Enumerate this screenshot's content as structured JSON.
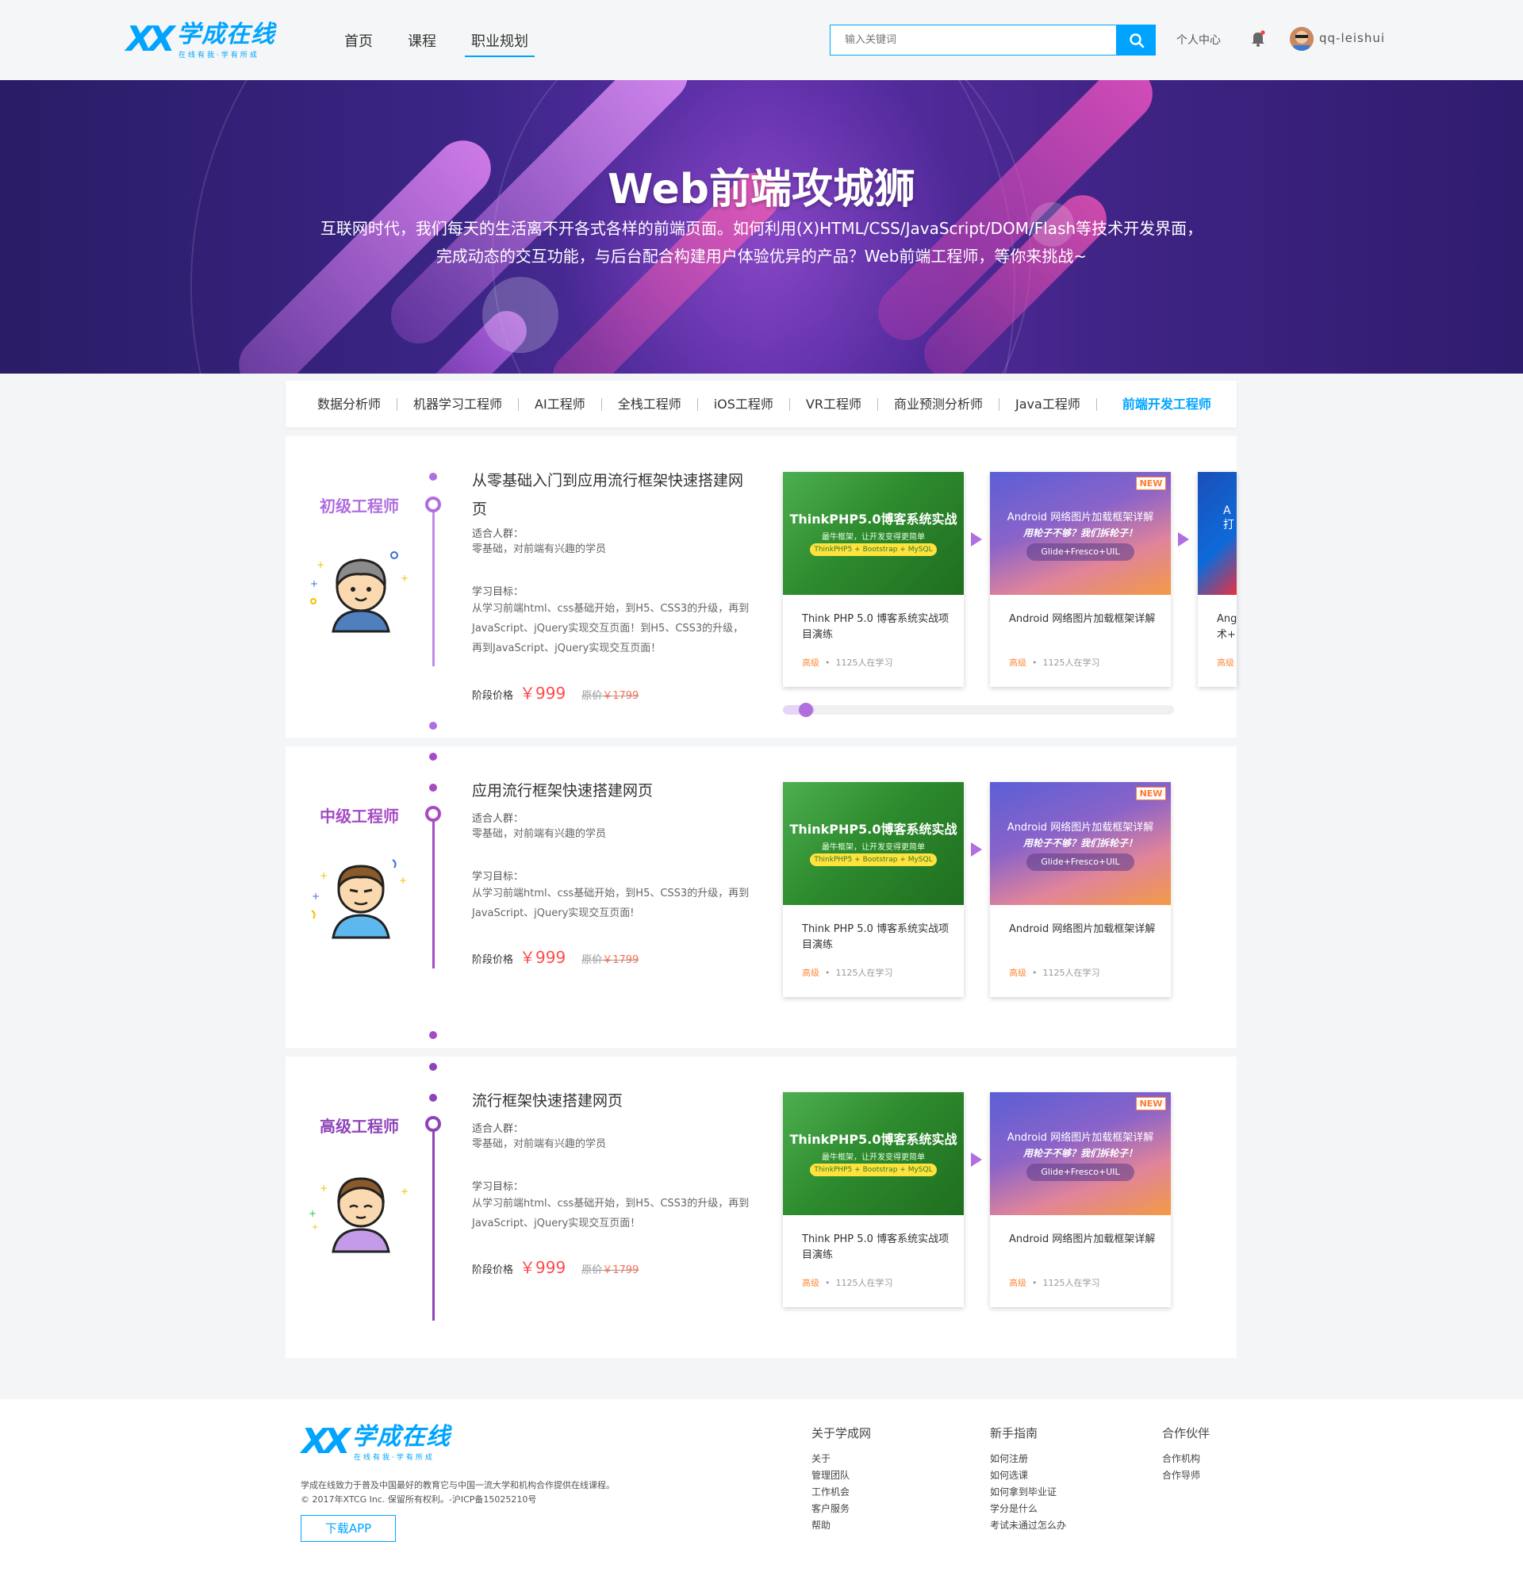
{
  "header": {
    "logo_name": "学成在线",
    "logo_tagline": "在线有我·学有所成",
    "nav": [
      "首页",
      "课程",
      "职业规划"
    ],
    "search_placeholder": "输入关键词",
    "personal_center": "个人中心",
    "username": "qq-leishui"
  },
  "banner": {
    "title": "Web前端攻城狮",
    "desc_line1": "互联网时代，我们每天的生活离不开各式各样的前端页面。如何利用(X)HTML/CSS/JavaScript/DOM/Flash等技术开发界面，",
    "desc_line2": "完成动态的交互功能，与后台配合构建用户体验优异的产品？Web前端工程师，等你来挑战~"
  },
  "tabs": [
    "数据分析师",
    "机器学习工程师",
    "AI工程师",
    "全栈工程师",
    "iOS工程师",
    "VR工程师",
    "商业预测分析师",
    "Java工程师",
    "前端开发工程师"
  ],
  "sections": [
    {
      "level": "初级工程师",
      "level_color": "#b06ee0",
      "title": "从零基础入门到应用流行框架快速搭建网页",
      "audience_label": "适合人群：",
      "audience": "零基础，对前端有兴趣的学员",
      "goal_label": "学习目标：",
      "goal": "从学习前端html、css基础开始，到H5、CSS3的升级，再到JavaScript、jQuery实现交互页面！到H5、CSS3的升级，再到JavaScript、jQuery实现交互页面！",
      "price_label": "阶段价格",
      "price": "￥999",
      "orig_label": "原价",
      "orig_price": "￥1799"
    },
    {
      "level": "中级工程师",
      "level_color": "#a64bc4",
      "title": "应用流行框架快速搭建网页",
      "audience_label": "适合人群：",
      "audience": "零基础，对前端有兴趣的学员",
      "goal_label": "学习目标：",
      "goal": "从学习前端html、css基础开始，到H5、CSS3的升级，再到JavaScript、jQuery实现交互页面!",
      "price_label": "阶段价格",
      "price": "￥999",
      "orig_label": "原价",
      "orig_price": "￥1799"
    },
    {
      "level": "高级工程师",
      "level_color": "#8e44b8",
      "title": "流行框架快速搭建网页",
      "audience_label": "适合人群：",
      "audience": "零基础，对前端有兴趣的学员",
      "goal_label": "学习目标：",
      "goal": "从学习前端html、css基础开始，到H5、CSS3的升级，再到JavaScript、jQuery实现交互页面！",
      "price_label": "阶段价格",
      "price": "￥999",
      "orig_label": "原价",
      "orig_price": "￥1799"
    }
  ],
  "cards": {
    "php": {
      "banner_title": "ThinkPHP5.0博客系统实战",
      "banner_sub": "最牛框架，让开发变得更简单",
      "banner_pill": "ThinkPHP5 + Bootstrap + MySQL",
      "name": "Think PHP 5.0 博客系统实战项目演练",
      "level": "高级",
      "learners": "1125人在学习"
    },
    "android": {
      "banner_title": "Android 网络图片加载框架详解",
      "banner_sub": "用轮子不够？我们拆轮子！",
      "banner_pill": "Glide+Fresco+UIL",
      "badge": "NEW",
      "name": "Android 网络图片加载框架详解",
      "level": "高级",
      "learners": "1125人在学习"
    },
    "partial": {
      "banner_text": "A 打",
      "name": "Ang 术+",
      "level": "高级"
    }
  },
  "footer": {
    "logo_name": "学成在线",
    "logo_tagline": "在线有我·学有所成",
    "desc": "学成在线致力于普及中国最好的教育它与中国一流大学和机构合作提供在线课程。",
    "copyright": "© 2017年XTCG Inc. 保留所有权利。-沪ICP备15025210号",
    "download_btn": "下载APP",
    "col1": {
      "title": "关于学成网",
      "items": [
        "关于",
        "管理团队",
        "工作机会",
        "客户服务",
        "帮助"
      ]
    },
    "col2": {
      "title": "新手指南",
      "items": [
        "如何注册",
        "如何选课",
        "如何拿到毕业证",
        "学分是什么",
        "考试未通过怎么办"
      ]
    },
    "col3": {
      "title": "合作伙伴",
      "items": [
        "合作机构",
        "合作导师"
      ]
    }
  },
  "colors": {
    "accent": "#00a4ff",
    "price": "#ff4b4b",
    "purple": "#b06ee0"
  }
}
